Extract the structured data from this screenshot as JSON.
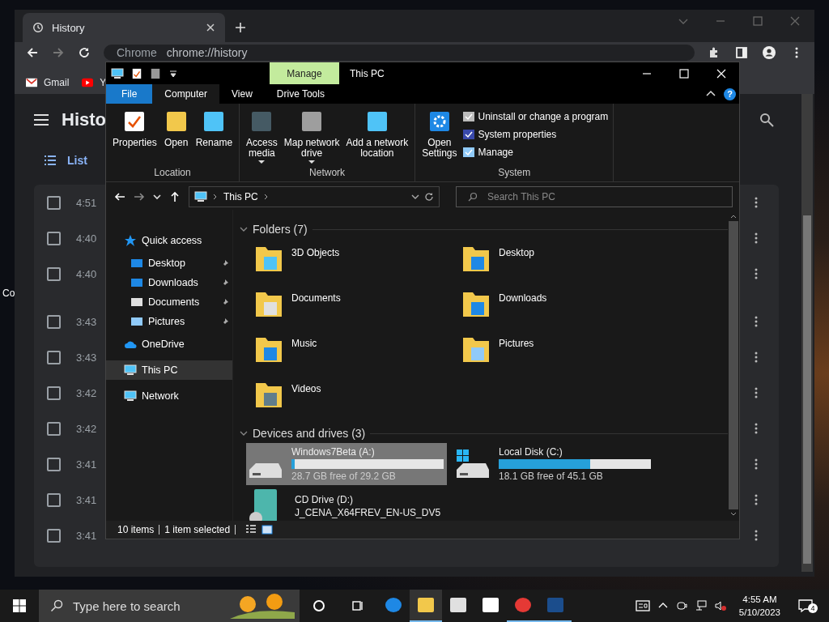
{
  "desktop": {
    "icon_label": "Co"
  },
  "browser": {
    "tab": {
      "title": "History"
    },
    "address": {
      "site": "Chrome",
      "url": "chrome://history"
    },
    "bookmarks": [
      "Gmail",
      "Y"
    ],
    "page_title": "Histo",
    "nav": {
      "label": "List",
      "selected": true
    },
    "rows": [
      {
        "time": "4:51",
        "checked": false
      },
      {
        "time": "4:40",
        "checked": false
      },
      {
        "time": "4:40",
        "checked": false
      },
      {
        "time": "3:43",
        "checked": false
      },
      {
        "time": "3:43",
        "checked": false
      },
      {
        "time": "3:42",
        "checked": false
      },
      {
        "time": "3:42",
        "checked": false
      },
      {
        "time": "3:41",
        "checked": false
      },
      {
        "time": "3:41",
        "checked": false
      },
      {
        "time": "3:41",
        "checked": false
      }
    ]
  },
  "explorer": {
    "context_tab": "Manage",
    "title": "This PC",
    "ribbon_tabs": [
      {
        "label": "File",
        "kind": "file",
        "selected": false
      },
      {
        "label": "Computer",
        "kind": "tab",
        "selected": true
      },
      {
        "label": "View",
        "kind": "tab",
        "selected": false
      },
      {
        "label": "Drive Tools",
        "kind": "tab",
        "selected": false
      }
    ],
    "help_icon": "?",
    "ribbon_groups": [
      {
        "name": "Location",
        "buttons": [
          {
            "lines": [
              "Properties"
            ],
            "dropdown": false
          },
          {
            "lines": [
              "Open"
            ],
            "dropdown": false
          },
          {
            "lines": [
              "Rename"
            ],
            "dropdown": false
          }
        ]
      },
      {
        "name": "Network",
        "buttons": [
          {
            "lines": [
              "Access",
              "media"
            ],
            "dropdown": true
          },
          {
            "lines": [
              "Map network",
              "drive"
            ],
            "dropdown": true
          },
          {
            "lines": [
              "Add a network",
              "location"
            ],
            "dropdown": false
          }
        ]
      },
      {
        "name": "System",
        "buttons": [
          {
            "lines": [
              "Open",
              "Settings"
            ],
            "dropdown": false
          }
        ],
        "small_buttons": [
          "Uninstall or change a program",
          "System properties",
          "Manage"
        ]
      }
    ],
    "address": {
      "crumbs": [
        "This PC"
      ]
    },
    "search": {
      "placeholder": "Search This PC"
    },
    "nav_pane": [
      {
        "label": "Quick access",
        "selected": false,
        "children": [
          {
            "label": "Desktop",
            "pinned": true,
            "selected": false
          },
          {
            "label": "Downloads",
            "pinned": true,
            "selected": false
          },
          {
            "label": "Documents",
            "pinned": true,
            "selected": false
          },
          {
            "label": "Pictures",
            "pinned": true,
            "selected": false
          }
        ]
      },
      {
        "label": "OneDrive",
        "selected": false
      },
      {
        "label": "This PC",
        "selected": true
      },
      {
        "label": "Network",
        "selected": false
      }
    ],
    "groups": [
      {
        "title": "Folders (7)",
        "kind": "folders",
        "expanded": true,
        "items": [
          {
            "name": "3D Objects"
          },
          {
            "name": "Desktop"
          },
          {
            "name": "Documents"
          },
          {
            "name": "Downloads"
          },
          {
            "name": "Music"
          },
          {
            "name": "Pictures"
          },
          {
            "name": "Videos"
          }
        ]
      },
      {
        "title": "Devices and drives (3)",
        "kind": "drives",
        "expanded": true,
        "items": [
          {
            "name": "Windows7Beta (A:)",
            "kind": "disk",
            "level": 0.02,
            "free": "28.7 GB free of 29.2 GB",
            "selected": true
          },
          {
            "name": "Local Disk (C:)",
            "kind": "system",
            "level": 0.6,
            "free": "18.1 GB free of 45.1 GB",
            "selected": false
          },
          {
            "name": "CD Drive (D:)",
            "kind": "cd",
            "label": "J_CENA_X64FREV_EN-US_DV5",
            "selected": false
          }
        ]
      }
    ],
    "status_bar": {
      "items": "10 items",
      "selection": "1 item selected"
    }
  },
  "taskbar": {
    "search": {
      "placeholder": "Type here to search"
    },
    "apps": [
      {
        "running": false,
        "active": false
      },
      {
        "running": true,
        "active": true
      },
      {
        "running": false,
        "active": false
      },
      {
        "running": false,
        "active": false
      },
      {
        "running": true,
        "active": false
      },
      {
        "running": true,
        "active": false
      }
    ],
    "clock": {
      "time": "4:55 AM",
      "date": "5/10/2023"
    },
    "notifications": {
      "count": "4"
    }
  }
}
